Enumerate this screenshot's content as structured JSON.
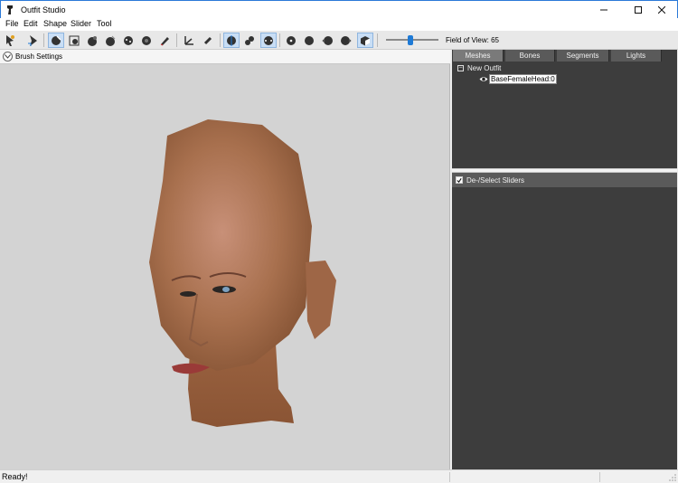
{
  "window": {
    "title": "Outfit Studio",
    "controls": {
      "minimize": "—",
      "maximize": "☐",
      "close": "✕"
    }
  },
  "menu": {
    "items": [
      "File",
      "Edit",
      "Shape",
      "Slider",
      "Tool"
    ]
  },
  "toolbar": {
    "field_of_view_label": "Field of View: 65",
    "field_of_view_value": 65,
    "buttons": [
      {
        "name": "select-tool",
        "icon": "arrow-icon",
        "active": false
      },
      {
        "name": "transform-tool",
        "icon": "move-icon",
        "active": false
      },
      {
        "name": "mask-brush",
        "icon": "mask-brush-icon",
        "active": true
      },
      {
        "name": "inflate-brush",
        "icon": "inflate-brush-icon",
        "active": false
      },
      {
        "name": "deflate-brush",
        "icon": "deflate-brush-icon",
        "active": false
      },
      {
        "name": "move-brush",
        "icon": "move-brush-icon",
        "active": false
      },
      {
        "name": "smooth-brush",
        "icon": "smooth-brush-icon",
        "active": false
      },
      {
        "name": "undiff-brush",
        "icon": "undiff-brush-icon",
        "active": false
      },
      {
        "name": "weight-brush",
        "icon": "weight-brush-icon",
        "active": false
      },
      {
        "name": "color-brush",
        "icon": "color-brush-icon",
        "active": false
      },
      {
        "name": "pivot-tool",
        "icon": "pivot-icon",
        "active": false
      },
      {
        "name": "vertex-edit",
        "icon": "vertex-edit-icon",
        "active": false
      },
      {
        "name": "view-front",
        "icon": "front-view-icon",
        "active": true
      },
      {
        "name": "view-side",
        "icon": "side-view-icon",
        "active": false
      },
      {
        "name": "view-top",
        "icon": "top-view-icon",
        "active": true
      },
      {
        "name": "view-persp-1",
        "icon": "sphere-dot-icon",
        "active": false
      },
      {
        "name": "view-persp-2",
        "icon": "sphere-icon",
        "active": false
      },
      {
        "name": "view-persp-3",
        "icon": "sphere-left-icon",
        "active": false
      },
      {
        "name": "view-persp-4",
        "icon": "sphere-right-icon",
        "active": false
      },
      {
        "name": "view-cube",
        "icon": "cube-icon",
        "active": true
      }
    ]
  },
  "viewport": {
    "brush_settings_label": "Brush Settings",
    "background": "#d3d3d3"
  },
  "right_panel": {
    "tabs": [
      {
        "label": "Meshes",
        "active": true
      },
      {
        "label": "Bones",
        "active": false
      },
      {
        "label": "Segments",
        "active": false
      },
      {
        "label": "Lights",
        "active": false
      }
    ],
    "tree": {
      "root_label": "New Outfit",
      "root_expander": "−",
      "child_label": "BaseFemaleHead:0",
      "child_icon": "eye-icon"
    },
    "sliders_header_label": "De-/Select Sliders",
    "sliders_checked": true
  },
  "statusbar": {
    "text": "Ready!"
  },
  "colors": {
    "panel_dark": "#3d3d3d",
    "tab_gray": "#5a5a5a",
    "accent_blue": "#1e7ad6",
    "window_border": "#2b79d8"
  }
}
